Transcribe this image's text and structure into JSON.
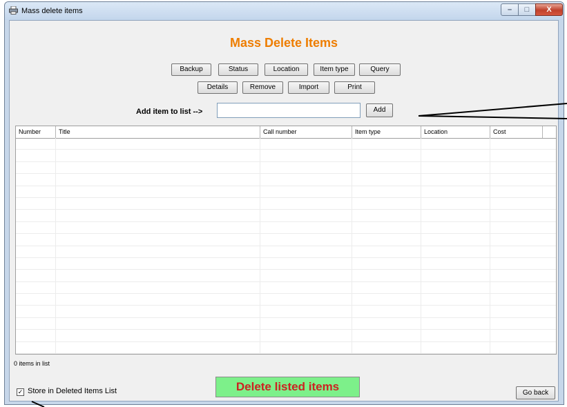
{
  "window": {
    "title": "Mass delete items",
    "controls": {
      "minimize": "–",
      "maximize": "□",
      "close": "X"
    }
  },
  "heading": "Mass Delete Items",
  "toolbar_row1": [
    "Backup",
    "Status",
    "Location",
    "Item type",
    "Query"
  ],
  "toolbar_row2": [
    "Details",
    "Remove",
    "Import",
    "Print"
  ],
  "add_item": {
    "label": "Add item to list -->",
    "input_value": "",
    "button": "Add"
  },
  "table": {
    "columns": [
      "Number",
      "Title",
      "Call number",
      "Item type",
      "Location",
      "Cost"
    ],
    "rows": []
  },
  "items_count": "0 items in list",
  "store_checkbox": {
    "label": "Store in Deleted Items List",
    "checked": true,
    "mark": "✓"
  },
  "delete_button": "Delete listed items",
  "go_back_button": "Go back",
  "colors": {
    "heading": "#ee7d00",
    "delete_bg": "#7df08a",
    "delete_text": "#cc2222"
  }
}
